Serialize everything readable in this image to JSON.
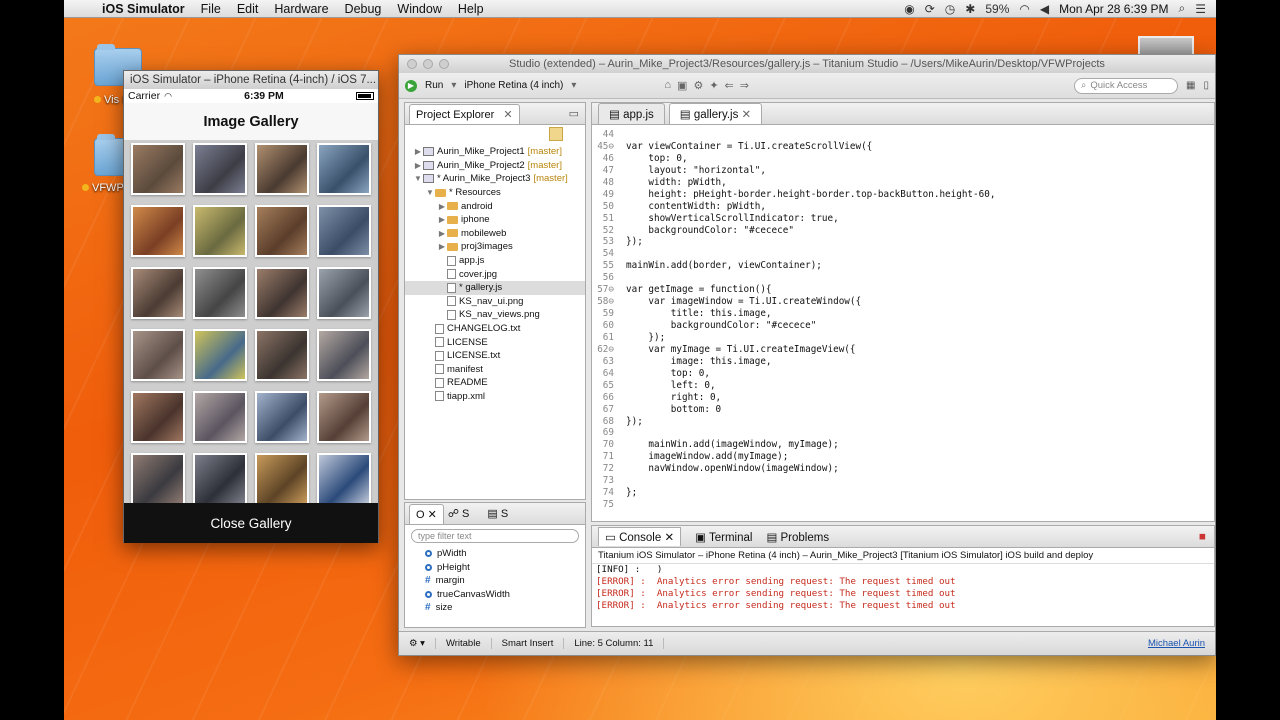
{
  "menubar": {
    "app_name": "iOS Simulator",
    "items": [
      "File",
      "Edit",
      "Hardware",
      "Debug",
      "Window",
      "Help"
    ],
    "battery": "59%",
    "clock": "Mon Apr 28  6:39 PM"
  },
  "desktop": {
    "label1": "Vis\nFramew",
    "label2": "VFWPro"
  },
  "simulator": {
    "window_title": "iOS Simulator – iPhone Retina (4-inch) / iOS 7...",
    "carrier": "Carrier",
    "time": "6:39 PM",
    "nav_title": "Image Gallery",
    "close_button": "Close Gallery",
    "photos": 24
  },
  "studio": {
    "window_title": "Studio (extended) – Aurin_Mike_Project3/Resources/gallery.js – Titanium Studio – /Users/MikeAurin/Desktop/VFWProjects",
    "run_label": "Run",
    "target_label": "iPhone Retina (4 inch)",
    "quick_access_placeholder": "Quick Access",
    "project_explorer_title": "Project Explorer",
    "tree": [
      {
        "label": "Aurin_Mike_Project1",
        "branch": "[master]",
        "depth": 0,
        "type": "project",
        "twisty": "▶"
      },
      {
        "label": "Aurin_Mike_Project2",
        "branch": "[master]",
        "depth": 0,
        "type": "project",
        "twisty": "▶"
      },
      {
        "label": "* Aurin_Mike_Project3",
        "branch": "[master]",
        "depth": 0,
        "type": "project",
        "twisty": "▼"
      },
      {
        "label": "* Resources",
        "branch": "",
        "depth": 1,
        "type": "folder",
        "twisty": "▼"
      },
      {
        "label": "android",
        "branch": "",
        "depth": 2,
        "type": "folder",
        "twisty": "▶"
      },
      {
        "label": "iphone",
        "branch": "",
        "depth": 2,
        "type": "folder",
        "twisty": "▶"
      },
      {
        "label": "mobileweb",
        "branch": "",
        "depth": 2,
        "type": "folder",
        "twisty": "▶"
      },
      {
        "label": "proj3images",
        "branch": "",
        "depth": 2,
        "type": "folder",
        "twisty": "▶"
      },
      {
        "label": "app.js",
        "branch": "",
        "depth": 2,
        "type": "file",
        "twisty": ""
      },
      {
        "label": "cover.jpg",
        "branch": "",
        "depth": 2,
        "type": "file",
        "twisty": ""
      },
      {
        "label": "* gallery.js",
        "branch": "",
        "depth": 2,
        "type": "file",
        "twisty": "",
        "selected": true
      },
      {
        "label": "KS_nav_ui.png",
        "branch": "",
        "depth": 2,
        "type": "file",
        "twisty": ""
      },
      {
        "label": "KS_nav_views.png",
        "branch": "",
        "depth": 2,
        "type": "file",
        "twisty": ""
      },
      {
        "label": "CHANGELOG.txt",
        "branch": "",
        "depth": 1,
        "type": "file",
        "twisty": ""
      },
      {
        "label": "LICENSE",
        "branch": "",
        "depth": 1,
        "type": "file",
        "twisty": ""
      },
      {
        "label": "LICENSE.txt",
        "branch": "",
        "depth": 1,
        "type": "file",
        "twisty": ""
      },
      {
        "label": "manifest",
        "branch": "",
        "depth": 1,
        "type": "file",
        "twisty": ""
      },
      {
        "label": "README",
        "branch": "",
        "depth": 1,
        "type": "file",
        "twisty": ""
      },
      {
        "label": "tiapp.xml",
        "branch": "",
        "depth": 1,
        "type": "file",
        "twisty": ""
      }
    ],
    "outline_tabs": [
      "O",
      "S",
      "S"
    ],
    "filter_placeholder": "type filter text",
    "outline_items": [
      {
        "label": "pWidth",
        "kind": "dot"
      },
      {
        "label": "pHeight",
        "kind": "dot"
      },
      {
        "label": "margin",
        "kind": "hash"
      },
      {
        "label": "trueCanvasWidth",
        "kind": "dot"
      },
      {
        "label": "size",
        "kind": "hash"
      }
    ],
    "editor_tabs": [
      {
        "label": "app.js",
        "active": false
      },
      {
        "label": "gallery.js",
        "active": true
      }
    ],
    "code": [
      {
        "n": "44",
        "t": ""
      },
      {
        "n": "45⊖",
        "t": "var viewContainer = Ti.UI.createScrollView({"
      },
      {
        "n": "46",
        "t": "    top: 0,"
      },
      {
        "n": "47",
        "t": "    layout: \"horizontal\","
      },
      {
        "n": "48",
        "t": "    width: pWidth,"
      },
      {
        "n": "49",
        "t": "    height: pHeight-border.height-border.top-backButton.height-60,"
      },
      {
        "n": "50",
        "t": "    contentWidth: pWidth,"
      },
      {
        "n": "51",
        "t": "    showVerticalScrollIndicator: true,"
      },
      {
        "n": "52",
        "t": "    backgroundColor: \"#cecece\""
      },
      {
        "n": "53",
        "t": "});"
      },
      {
        "n": "54",
        "t": ""
      },
      {
        "n": "55",
        "t": "mainWin.add(border, viewContainer);"
      },
      {
        "n": "56",
        "t": ""
      },
      {
        "n": "57⊖",
        "t": "var getImage = function(){"
      },
      {
        "n": "58⊖",
        "t": "    var imageWindow = Ti.UI.createWindow({"
      },
      {
        "n": "59",
        "t": "        title: this.image,"
      },
      {
        "n": "60",
        "t": "        backgroundColor: \"#cecece\""
      },
      {
        "n": "61",
        "t": "    });"
      },
      {
        "n": "62⊖",
        "t": "    var myImage = Ti.UI.createImageView({"
      },
      {
        "n": "63",
        "t": "        image: this.image,"
      },
      {
        "n": "64",
        "t": "        top: 0,"
      },
      {
        "n": "65",
        "t": "        left: 0,"
      },
      {
        "n": "66",
        "t": "        right: 0,"
      },
      {
        "n": "67",
        "t": "        bottom: 0"
      },
      {
        "n": "68",
        "t": "});"
      },
      {
        "n": "69",
        "t": ""
      },
      {
        "n": "70",
        "t": "    mainWin.add(imageWindow, myImage);"
      },
      {
        "n": "71",
        "t": "    imageWindow.add(myImage);"
      },
      {
        "n": "72",
        "t": "    navWindow.openWindow(imageWindow);"
      },
      {
        "n": "73",
        "t": ""
      },
      {
        "n": "74",
        "t": "};"
      },
      {
        "n": "75",
        "t": ""
      }
    ],
    "console_tabs": [
      "Console",
      "Terminal",
      "Problems"
    ],
    "console_header": "Titanium iOS Simulator – iPhone Retina (4 inch) – Aurin_Mike_Project3 [Titanium iOS Simulator] iOS build and deploy",
    "console_lines": [
      {
        "text": "[INFO] :   )",
        "error": false
      },
      {
        "text": "[ERROR] :  Analytics error sending request: The request timed out",
        "error": true
      },
      {
        "text": "[ERROR] :  Analytics error sending request: The request timed out",
        "error": true
      },
      {
        "text": "[ERROR] :  Analytics error sending request: The request timed out",
        "error": true
      }
    ],
    "status": {
      "writable": "Writable",
      "insert": "Smart Insert",
      "position": "Line: 5 Column: 11",
      "user": "Michael Aurin"
    }
  }
}
